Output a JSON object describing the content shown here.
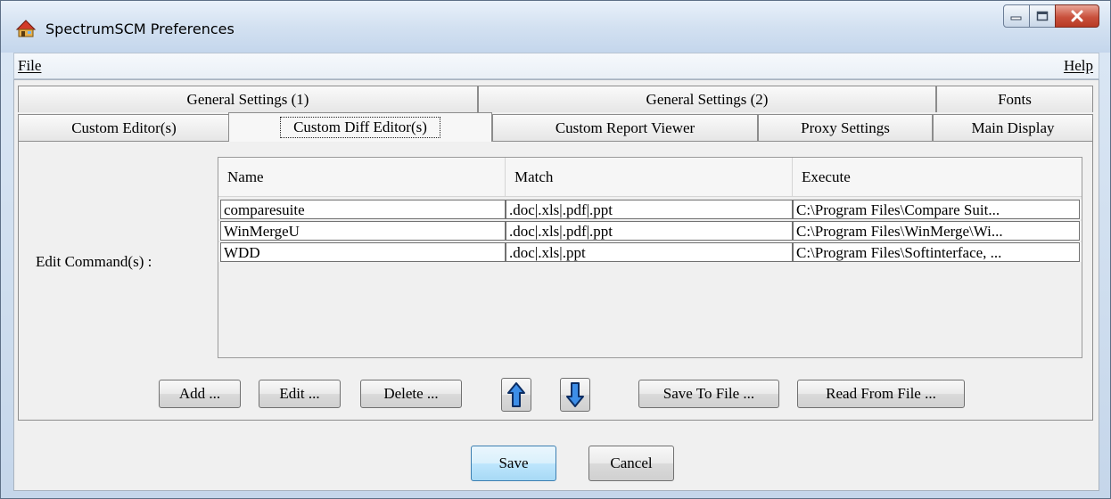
{
  "window": {
    "title": "SpectrumSCM Preferences",
    "minimize_glyph": "–",
    "maximize_glyph": "□",
    "close_glyph": "X"
  },
  "menu": {
    "file": "File",
    "help": "Help"
  },
  "tabs_row1": [
    {
      "label": "General Settings (1)"
    },
    {
      "label": "General Settings (2)"
    },
    {
      "label": "Fonts"
    }
  ],
  "tabs_row2": [
    {
      "label": "Custom Editor(s)"
    },
    {
      "label": "Custom Diff Editor(s)",
      "active": true
    },
    {
      "label": "Custom Report Viewer"
    },
    {
      "label": "Proxy Settings"
    },
    {
      "label": "Main Display"
    }
  ],
  "panel": {
    "edit_label": "Edit Command(s) :",
    "columns": [
      "Name",
      "Match",
      "Execute"
    ],
    "rows": [
      [
        "comparesuite",
        ".doc|.xls|.pdf|.ppt",
        "C:\\Program Files\\Compare Suit..."
      ],
      [
        "WinMergeU",
        ".doc|.xls|.pdf|.ppt",
        "C:\\Program Files\\WinMerge\\Wi..."
      ],
      [
        "WDD",
        ".doc|.xls|.ppt",
        "C:\\Program Files\\Softinterface, ..."
      ]
    ]
  },
  "buttons": {
    "add": "Add ...",
    "edit": "Edit ...",
    "delete": "Delete ...",
    "save_to_file": "Save To File ...",
    "read_from_file": "Read From File ...",
    "save": "Save",
    "cancel": "Cancel"
  },
  "colors": {
    "arrow_fill": "#3d8ee8",
    "arrow_stroke": "#0b2d63",
    "close_button": "#c9513d"
  },
  "icons": {
    "app": "scm-app-icon",
    "up": "arrow-up-icon",
    "down": "arrow-down-icon"
  }
}
